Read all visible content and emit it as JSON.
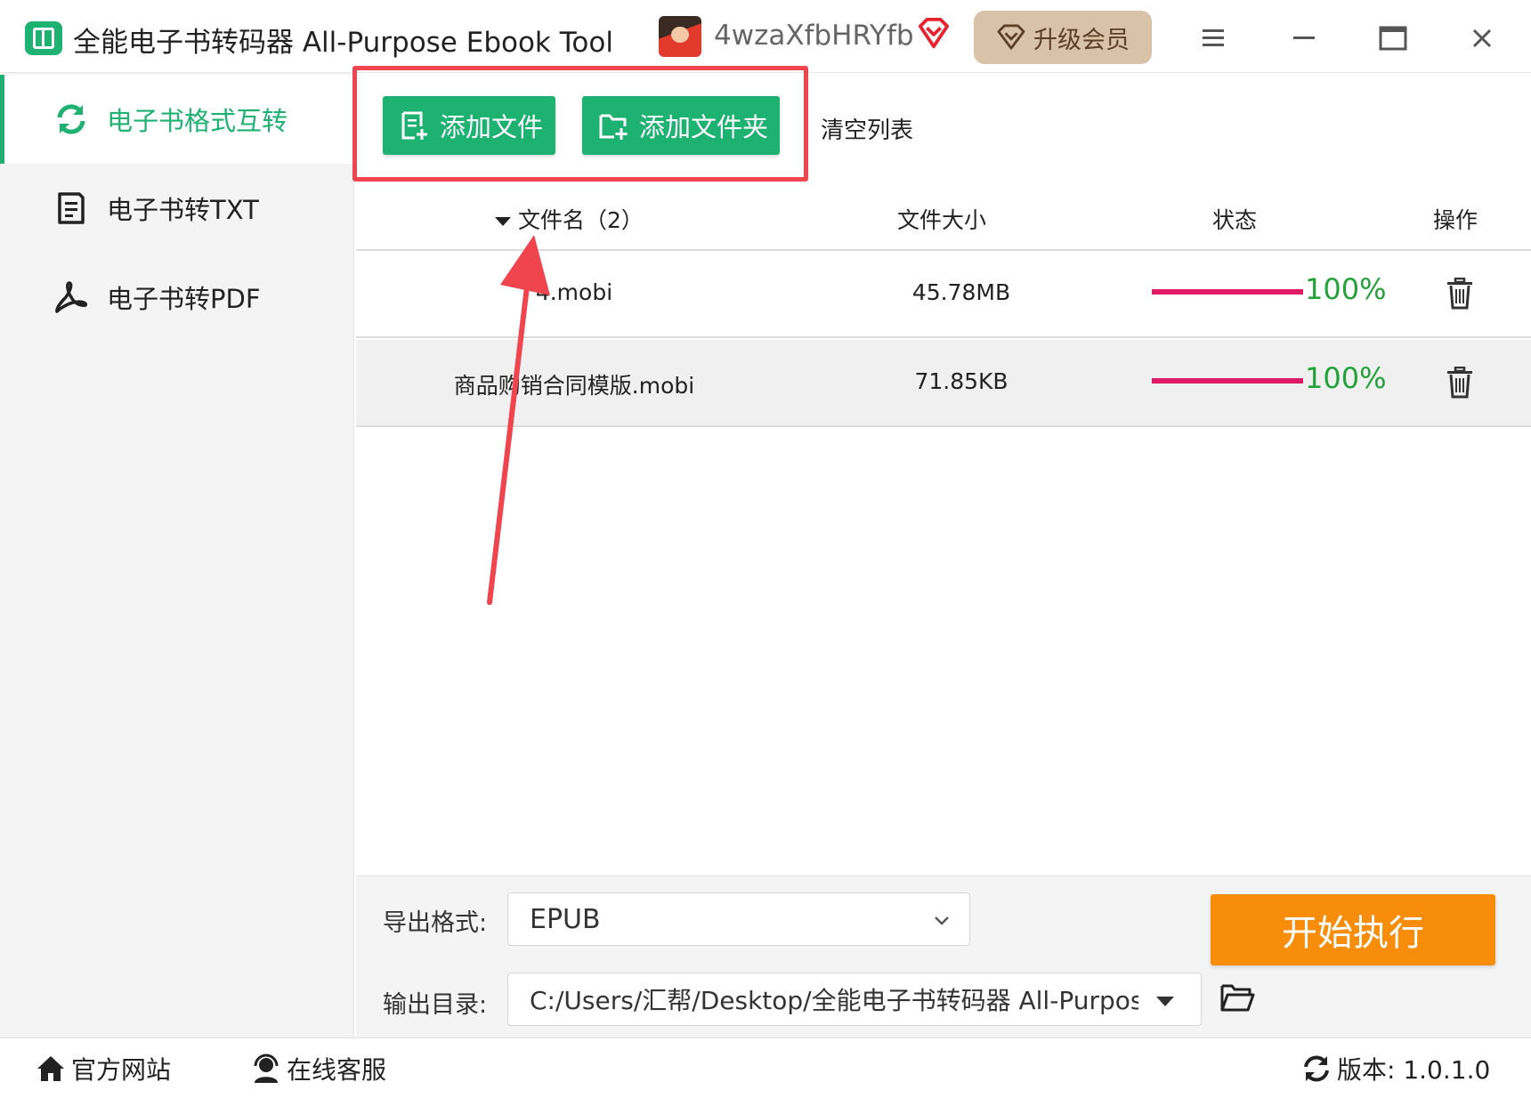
{
  "window": {
    "title": "全能电子书转码器 All-Purpose Ebook Tool",
    "username": "4wzaXfbHRYfb",
    "upgrade_label": "升级会员"
  },
  "sidebar": {
    "items": [
      {
        "label": "电子书格式互转",
        "icon": "refresh-icon",
        "active": true
      },
      {
        "label": "电子书转TXT",
        "icon": "document-icon",
        "active": false
      },
      {
        "label": "电子书转PDF",
        "icon": "pdf-icon",
        "active": false
      }
    ]
  },
  "toolbar": {
    "add_file_label": "添加文件",
    "add_folder_label": "添加文件夹",
    "clear_list_label": "清空列表"
  },
  "table": {
    "columns": [
      "文件名（2）",
      "文件大小",
      "状态",
      "操作"
    ],
    "rows": [
      {
        "name": "4.mobi",
        "size": "45.78MB",
        "progress": 1.0,
        "status": "100%"
      },
      {
        "name": "商品购销合同模版.mobi",
        "size": "71.85KB",
        "progress": 1.0,
        "status": "100%"
      }
    ]
  },
  "settings": {
    "format_label": "导出格式:",
    "format_value": "EPUB",
    "dir_label": "输出目录:",
    "dir_value": "C:/Users/汇帮/Desktop/全能电子书转码器 All-Purpose",
    "start_label": "开始执行"
  },
  "footer": {
    "site_label": "官方网站",
    "service_label": "在线客服",
    "version_label": "版本: 1.0.1.0"
  },
  "colors": {
    "brand_green": "#1db172",
    "start_orange": "#f88d0c",
    "progress_pink": "#e01d64",
    "percent_green": "#23a23a",
    "highlight_red": "#f0444e"
  }
}
